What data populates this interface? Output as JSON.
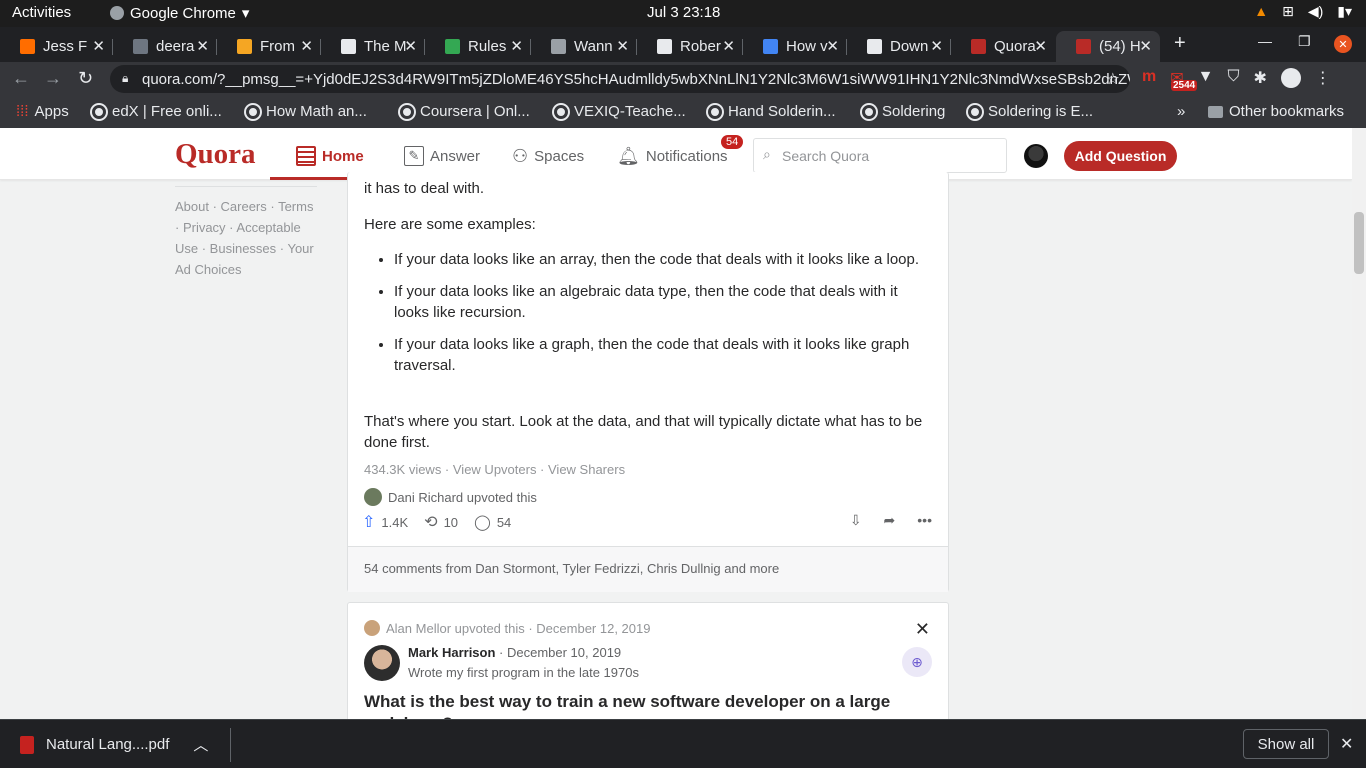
{
  "system": {
    "activities": "Activities",
    "app_name": "Google Chrome",
    "clock": "Jul 3  23:18"
  },
  "tabs": [
    {
      "title": "Jess F",
      "color": "#ff6d00"
    },
    {
      "title": "deera",
      "color": "#6e7681"
    },
    {
      "title": "From",
      "color": "#f5a623"
    },
    {
      "title": "The M",
      "color": "#e8eaed"
    },
    {
      "title": "Rules",
      "color": "#34a853"
    },
    {
      "title": "Wann",
      "color": "#9aa0a6"
    },
    {
      "title": "Rober",
      "color": "#e8eaed"
    },
    {
      "title": "How v",
      "color": "#4285f4"
    },
    {
      "title": "Down",
      "color": "#e8eaed"
    },
    {
      "title": "Quora",
      "color": "#b92b27"
    },
    {
      "title": "(54) H",
      "color": "#b92b27"
    }
  ],
  "address": {
    "url": "quora.com/?__pmsg__=+Yjd0dEJ2S3d4RW9ITm5jZDloME46YS5hcHAudmlldy5wbXNnLlN1Y2Nlc3M6W1siWW91IHN1Y2Nlc3NmdWxseSBsb2dnZWQ..."
  },
  "extensions": {
    "mail_badge": "2544"
  },
  "bookmarks": [
    "Apps",
    "edX | Free onli...",
    "How Math an...",
    "Coursera | Onl...",
    "VEXIQ-Teache...",
    "Hand Solderin...",
    "Soldering",
    "Soldering is E...",
    "»",
    "Other bookmarks"
  ],
  "quora": {
    "logo": "Quora",
    "nav": {
      "home": "Home",
      "answer": "Answer",
      "spaces": "Spaces",
      "notifications": "Notifications",
      "notif_count": "54"
    },
    "search_placeholder": "Search Quora",
    "add_question": "Add Question"
  },
  "sidebar": {
    "links": "About · Careers · Terms · Privacy · Acceptable Use · Businesses · Your Ad Choices"
  },
  "answer1": {
    "line_top": "it has to deal with.",
    "intro": "Here are some examples:",
    "bullets": [
      "If your data looks like an array, then the code that deals with it looks like a loop.",
      "If your data looks like an algebraic data type, then the code that deals with it looks like recursion.",
      "If your data looks like a graph, then the code that deals with it looks like graph traversal."
    ],
    "conclusion": "That's where you start. Look at the data, and that will typically dictate what has to be done first.",
    "stats": "434.3K views · View Upvoters · View Sharers",
    "upvote_note": "Dani Richard upvoted this",
    "upvotes": "1.4K",
    "shares": "10",
    "comments": "54",
    "comment_bar": "54 comments from Dan Stormont, Tyler Fedrizzi, Chris Dullnig and more"
  },
  "answer2": {
    "upvote_note": "Alan Mellor upvoted this · December 12, 2019",
    "author": "Mark Harrison",
    "date": " · December 10, 2019",
    "credential": "Wrote my first program in the late 1970s",
    "question": "What is the best way to train a new software developer on a large codebase?"
  },
  "download": {
    "file": "Natural Lang....pdf",
    "show_all": "Show all"
  }
}
